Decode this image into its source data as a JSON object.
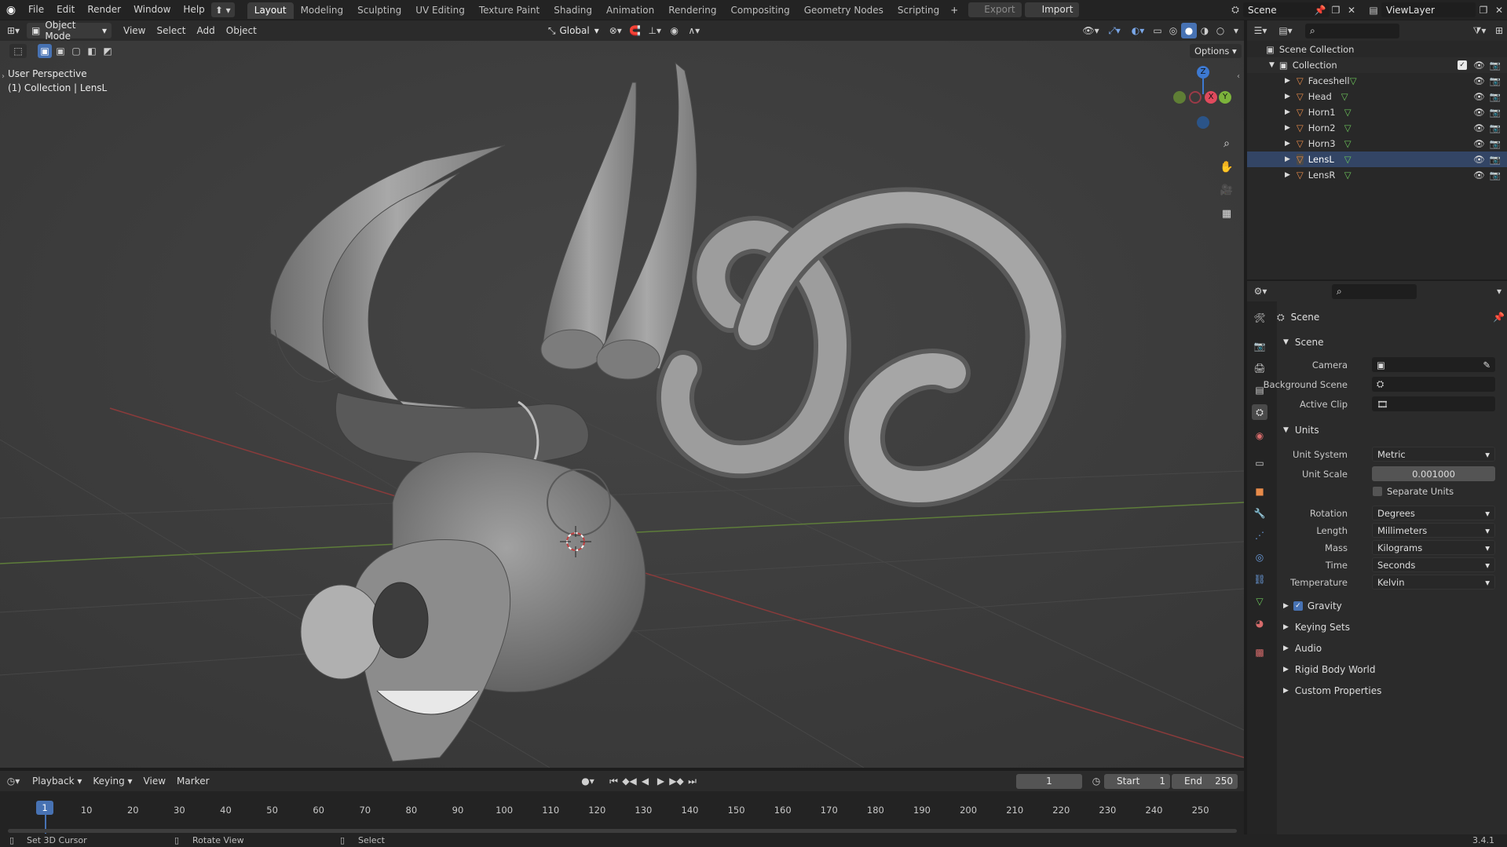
{
  "topbar": {
    "menus": [
      "File",
      "Edit",
      "Render",
      "Window",
      "Help"
    ],
    "workspaces": [
      "Layout",
      "Modeling",
      "Sculpting",
      "UV Editing",
      "Texture Paint",
      "Shading",
      "Animation",
      "Rendering",
      "Compositing",
      "Geometry Nodes",
      "Scripting"
    ],
    "active_workspace": "Layout",
    "export_label": "Export",
    "import_label": "Import",
    "scene_name": "Scene",
    "view_layer": "ViewLayer"
  },
  "viewport_header": {
    "mode": "Object Mode",
    "menus": [
      "View",
      "Select",
      "Add",
      "Object"
    ],
    "orientation": "Global",
    "options_label": "Options"
  },
  "viewport": {
    "perspective_label": "User Perspective",
    "context_label": "(1) Collection | LensL",
    "gizmo_axes": {
      "z": "Z",
      "x": "X",
      "y": "Y"
    }
  },
  "outliner": {
    "root": "Scene Collection",
    "collection": "Collection",
    "objects": [
      "Faceshell",
      "Head",
      "Horn1",
      "Horn2",
      "Horn3",
      "LensL",
      "LensR"
    ],
    "selected": "LensL"
  },
  "properties": {
    "context_title": "Scene",
    "scene_panel": {
      "title": "Scene",
      "camera_label": "Camera",
      "background_scene_label": "Background Scene",
      "active_clip_label": "Active Clip"
    },
    "units_panel": {
      "title": "Units",
      "unit_system_label": "Unit System",
      "unit_system": "Metric",
      "unit_scale_label": "Unit Scale",
      "unit_scale": "0.001000",
      "separate_units_label": "Separate Units",
      "rotation_label": "Rotation",
      "rotation": "Degrees",
      "length_label": "Length",
      "length": "Millimeters",
      "mass_label": "Mass",
      "mass": "Kilograms",
      "time_label": "Time",
      "time": "Seconds",
      "temperature_label": "Temperature",
      "temperature": "Kelvin"
    },
    "collapsed_panels": [
      "Gravity",
      "Keying Sets",
      "Audio",
      "Rigid Body World",
      "Custom Properties"
    ]
  },
  "timeline": {
    "menus": [
      "Playback",
      "Keying",
      "View",
      "Marker"
    ],
    "current_frame": "1",
    "start_label": "Start",
    "start": "1",
    "end_label": "End",
    "end": "250",
    "ticks": [
      "10",
      "20",
      "30",
      "40",
      "50",
      "60",
      "70",
      "80",
      "90",
      "100",
      "110",
      "120",
      "130",
      "140",
      "150",
      "160",
      "170",
      "180",
      "190",
      "200",
      "210",
      "220",
      "230",
      "240",
      "250"
    ],
    "playhead_label": "1"
  },
  "statusbar": {
    "hint1": "Set 3D Cursor",
    "hint2": "Rotate View",
    "hint3": "Select",
    "version": "3.4.1"
  },
  "colors": {
    "accent_blue": "#4772b3",
    "active_workspace_bg": "#3d3d3d",
    "viewport_bg": "#3d3d3d",
    "mesh_orange": "#e88b4a",
    "green_data": "#6cc45a"
  }
}
